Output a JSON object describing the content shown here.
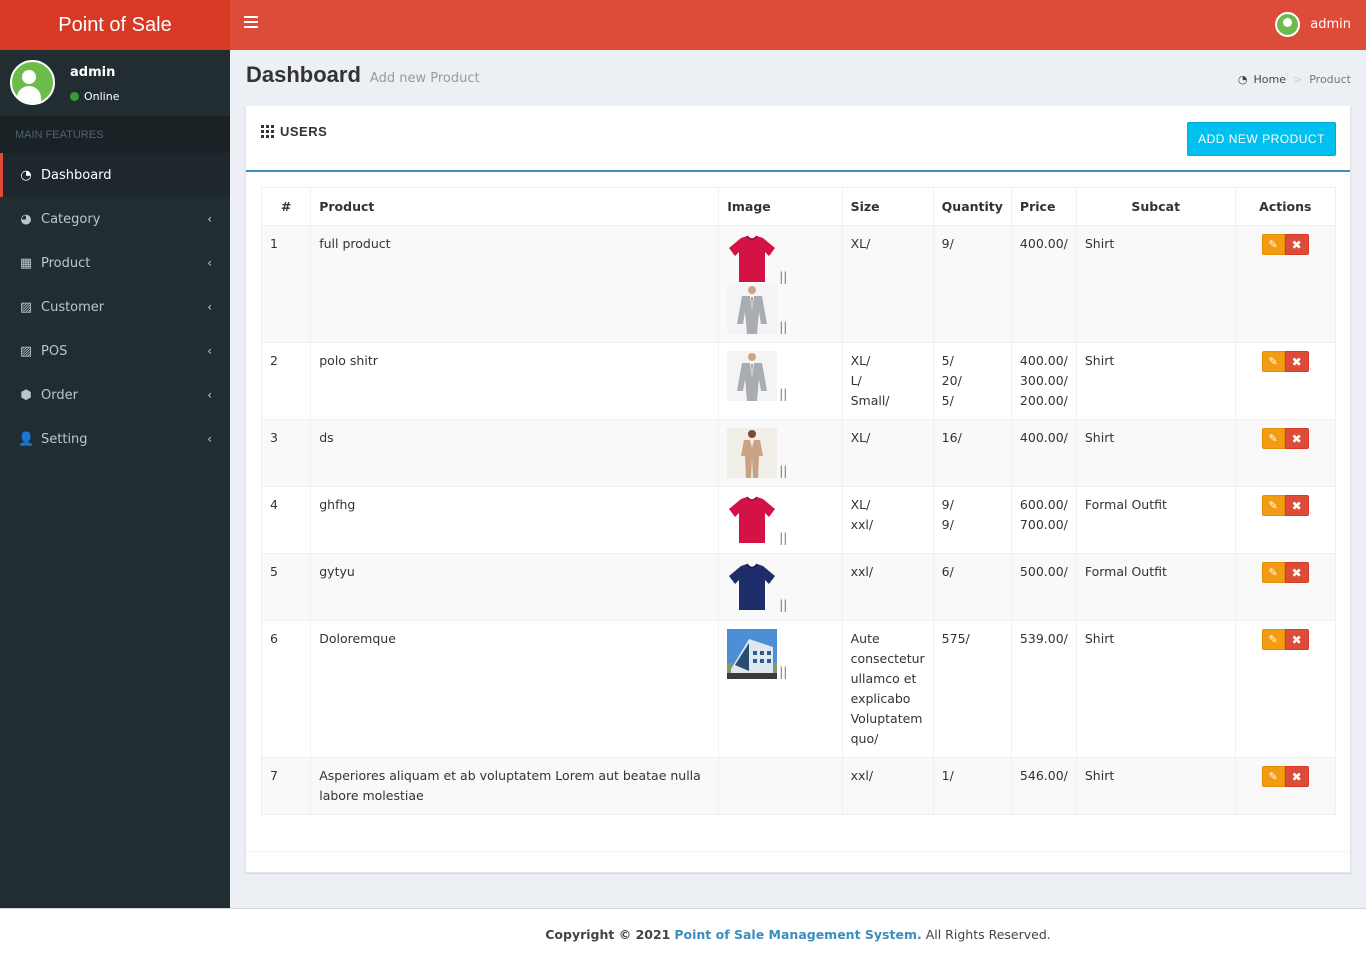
{
  "app": {
    "logo": "Point of Sale",
    "user": "admin"
  },
  "sidebar": {
    "user_name": "admin",
    "status": "Online",
    "section_header": "MAIN FEATURES",
    "items": [
      {
        "label": "Dashboard",
        "icon": "dashboard-icon"
      },
      {
        "label": "Category",
        "icon": "pie-chart-icon"
      },
      {
        "label": "Product",
        "icon": "grid-icon"
      },
      {
        "label": "Customer",
        "icon": "image-icon"
      },
      {
        "label": "POS",
        "icon": "image-icon"
      },
      {
        "label": "Order",
        "icon": "cube-icon"
      },
      {
        "label": "Setting",
        "icon": "user-icon"
      }
    ]
  },
  "page": {
    "title": "Dashboard",
    "subtitle": "Add new Product"
  },
  "breadcrumb": {
    "home": "Home",
    "current": "Product"
  },
  "box": {
    "title": "USERS",
    "add_button": "ADD NEW PRODUCT"
  },
  "table": {
    "headers": [
      "#",
      "Product",
      "Image",
      "Size",
      "Quantity",
      "Price",
      "Subcat",
      "Actions"
    ],
    "rows": [
      {
        "num": "1",
        "product": "full product",
        "images": [
          "red-tshirt",
          "grey-suit"
        ],
        "size": [
          "XL/"
        ],
        "qty": [
          "9/"
        ],
        "price": [
          "400.00/"
        ],
        "subcat": "Shirt"
      },
      {
        "num": "2",
        "product": "polo shitr",
        "images": [
          "grey-suit"
        ],
        "size": [
          "XL/",
          "L/",
          "Small/"
        ],
        "qty": [
          "5/",
          "20/",
          "5/"
        ],
        "price": [
          "400.00/",
          "300.00/",
          "200.00/"
        ],
        "subcat": "Shirt"
      },
      {
        "num": "3",
        "product": "ds",
        "images": [
          "beige-suit"
        ],
        "size": [
          "XL/"
        ],
        "qty": [
          "16/"
        ],
        "price": [
          "400.00/"
        ],
        "subcat": "Shirt"
      },
      {
        "num": "4",
        "product": "ghfhg",
        "images": [
          "red-tshirt"
        ],
        "size": [
          "XL/",
          "xxl/"
        ],
        "qty": [
          "9/",
          "9/"
        ],
        "price": [
          "600.00/",
          "700.00/"
        ],
        "subcat": "Formal Outfit"
      },
      {
        "num": "5",
        "product": "gytyu",
        "images": [
          "navy-tshirt"
        ],
        "size": [
          "xxl/"
        ],
        "qty": [
          "6/"
        ],
        "price": [
          "500.00/"
        ],
        "subcat": "Formal Outfit"
      },
      {
        "num": "6",
        "product": "Doloremque",
        "images": [
          "building"
        ],
        "size": [
          "Aute",
          "consectetur",
          "ullamco et",
          "explicabo",
          "Voluptatem",
          "quo/"
        ],
        "qty": [
          "575/"
        ],
        "price": [
          "539.00/"
        ],
        "subcat": "Shirt"
      },
      {
        "num": "7",
        "product": "Asperiores aliquam et ab voluptatem Lorem aut beatae nulla labore molestiae",
        "images": [],
        "size": [
          "xxl/"
        ],
        "qty": [
          "1/"
        ],
        "price": [
          "546.00/"
        ],
        "subcat": "Shirt"
      }
    ]
  },
  "footer": {
    "prefix": "Copyright © 2021",
    "link": "Point of Sale Management System.",
    "suffix": " All Rights Reserved."
  },
  "colors": {
    "header": "#dd4b39",
    "logo": "#d73925",
    "sidebar": "#222d32",
    "accent": "#00c0ef",
    "edit": "#f39c12",
    "delete": "#dd4b39"
  }
}
